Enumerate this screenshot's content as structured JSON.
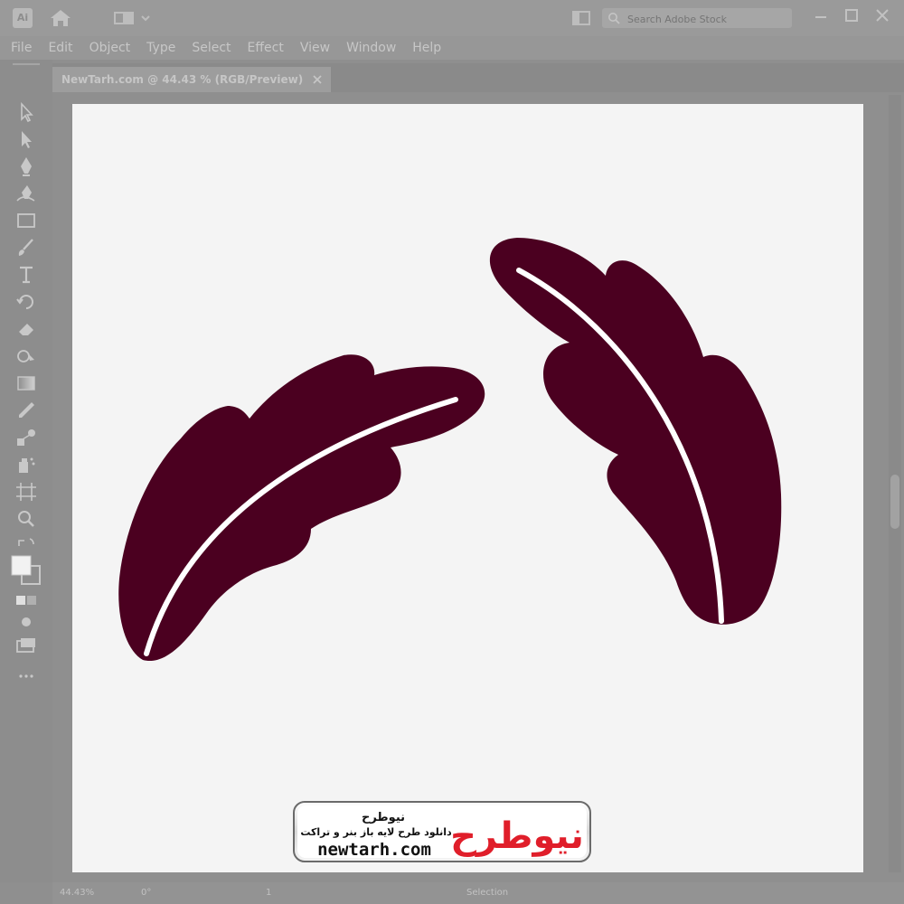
{
  "titlebar": {
    "app_logo_text": "Ai",
    "search_placeholder": "Search Adobe Stock"
  },
  "menu": [
    "File",
    "Edit",
    "Object",
    "Type",
    "Select",
    "Effect",
    "View",
    "Window",
    "Help"
  ],
  "document_tab": {
    "title": "NewTarh.com @ 44.43 % (RGB/Preview)",
    "close_symbol": "×"
  },
  "tools": [
    "selection-tool-icon",
    "direct-selection-tool-icon",
    "pen-tool-icon",
    "curvature-tool-icon",
    "rectangle-tool-icon",
    "paintbrush-tool-icon",
    "type-tool-icon",
    "rotate-tool-icon",
    "eraser-tool-icon",
    "shape-builder-tool-icon",
    "gradient-tool-icon",
    "eyedropper-tool-icon",
    "blend-tool-icon",
    "symbol-sprayer-tool-icon",
    "artboard-tool-icon",
    "zoom-tool-icon"
  ],
  "statusbar": {
    "zoom": "44.43%",
    "rotation": "0°",
    "artboard_number": "1",
    "current_tool": "Selection"
  },
  "artwork": {
    "fill_color": "#4b0020",
    "vein_color": "#ffffff",
    "artboard_color": "#f4f4f4"
  },
  "watermark": {
    "persian_name": "نیوطرح",
    "tagline": "دانلود طرح لایه باز بنر و تراکت",
    "domain": "newtarh.com",
    "logo_text": "نیوطرح",
    "logo_colors": [
      "#e01e2a",
      "#1b6fc0"
    ]
  }
}
